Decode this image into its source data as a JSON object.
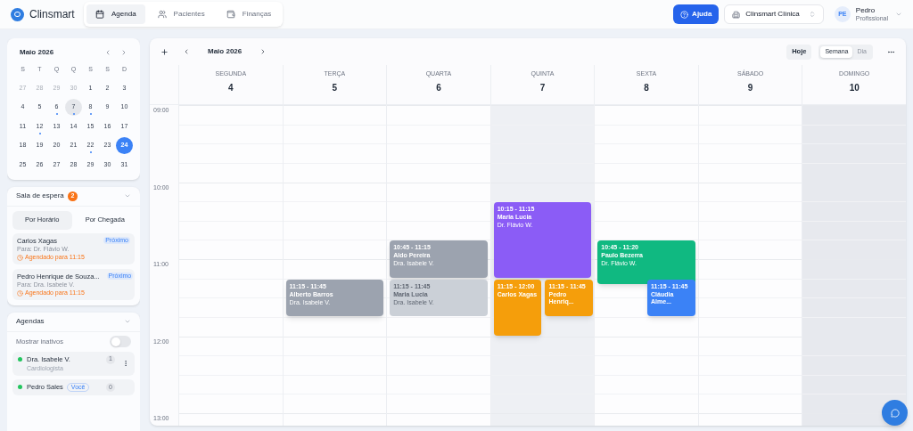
{
  "header": {
    "brand": "Clinsmart",
    "nav": [
      {
        "label": "Agenda",
        "kind": "calendar",
        "selected": true
      },
      {
        "label": "Pacientes",
        "kind": "users",
        "selected": false
      },
      {
        "label": "Finanças",
        "kind": "wallet",
        "selected": false
      }
    ],
    "help_button": "Ajuda",
    "clinic": "Clinsmart Clínica",
    "user": {
      "initials": "PE",
      "name": "Pedro",
      "role": "Profissional"
    }
  },
  "mini_calendar": {
    "title": "Maio 2026",
    "weekdays": [
      "S",
      "T",
      "Q",
      "Q",
      "S",
      "S",
      "D"
    ],
    "days": [
      {
        "label": "27",
        "muted": true,
        "today": false,
        "selected": false,
        "dot": false
      },
      {
        "label": "28",
        "muted": true,
        "today": false,
        "selected": false,
        "dot": false
      },
      {
        "label": "29",
        "muted": true,
        "today": false,
        "selected": false,
        "dot": false
      },
      {
        "label": "30",
        "muted": true,
        "today": false,
        "selected": false,
        "dot": false
      },
      {
        "label": "1",
        "muted": false,
        "today": false,
        "selected": false,
        "dot": false
      },
      {
        "label": "2",
        "muted": false,
        "today": false,
        "selected": false,
        "dot": false
      },
      {
        "label": "3",
        "muted": false,
        "today": false,
        "selected": false,
        "dot": false
      },
      {
        "label": "4",
        "muted": false,
        "today": false,
        "selected": false,
        "dot": false
      },
      {
        "label": "5",
        "muted": false,
        "today": false,
        "selected": false,
        "dot": false
      },
      {
        "label": "6",
        "muted": false,
        "today": false,
        "selected": false,
        "dot": true
      },
      {
        "label": "7",
        "muted": false,
        "today": true,
        "selected": false,
        "dot": true
      },
      {
        "label": "8",
        "muted": false,
        "today": false,
        "selected": false,
        "dot": true
      },
      {
        "label": "9",
        "muted": false,
        "today": false,
        "selected": false,
        "dot": false
      },
      {
        "label": "10",
        "muted": false,
        "today": false,
        "selected": false,
        "dot": false
      },
      {
        "label": "11",
        "muted": false,
        "today": false,
        "selected": false,
        "dot": false
      },
      {
        "label": "12",
        "muted": false,
        "today": false,
        "selected": false,
        "dot": true
      },
      {
        "label": "13",
        "muted": false,
        "today": false,
        "selected": false,
        "dot": false
      },
      {
        "label": "14",
        "muted": false,
        "today": false,
        "selected": false,
        "dot": false
      },
      {
        "label": "15",
        "muted": false,
        "today": false,
        "selected": false,
        "dot": false
      },
      {
        "label": "16",
        "muted": false,
        "today": false,
        "selected": false,
        "dot": false
      },
      {
        "label": "17",
        "muted": false,
        "today": false,
        "selected": false,
        "dot": false
      },
      {
        "label": "18",
        "muted": false,
        "today": false,
        "selected": false,
        "dot": false
      },
      {
        "label": "19",
        "muted": false,
        "today": false,
        "selected": false,
        "dot": false
      },
      {
        "label": "20",
        "muted": false,
        "today": false,
        "selected": false,
        "dot": false
      },
      {
        "label": "21",
        "muted": false,
        "today": false,
        "selected": false,
        "dot": false
      },
      {
        "label": "22",
        "muted": false,
        "today": false,
        "selected": false,
        "dot": true
      },
      {
        "label": "23",
        "muted": false,
        "today": false,
        "selected": false,
        "dot": false
      },
      {
        "label": "24",
        "muted": false,
        "today": false,
        "selected": true,
        "dot": false
      },
      {
        "label": "25",
        "muted": false,
        "today": false,
        "selected": false,
        "dot": false
      },
      {
        "label": "26",
        "muted": false,
        "today": false,
        "selected": false,
        "dot": false
      },
      {
        "label": "27",
        "muted": false,
        "today": false,
        "selected": false,
        "dot": false
      },
      {
        "label": "28",
        "muted": false,
        "today": false,
        "selected": false,
        "dot": false
      },
      {
        "label": "29",
        "muted": false,
        "today": false,
        "selected": false,
        "dot": false
      },
      {
        "label": "30",
        "muted": false,
        "today": false,
        "selected": false,
        "dot": false
      },
      {
        "label": "31",
        "muted": false,
        "today": false,
        "selected": false,
        "dot": false
      }
    ]
  },
  "waiting_room": {
    "title": "Sala de espera",
    "count": "2",
    "tabs": [
      {
        "label": "Por Horário",
        "selected": true
      },
      {
        "label": "Por Chegada",
        "selected": false
      }
    ],
    "patients": [
      {
        "name": "Carlos Xagas",
        "badge": "Próximo",
        "doctor": "Para: Dr. Flávio W.",
        "scheduled": "Agendado para 11:15"
      },
      {
        "name": "Pedro Henrique de Souza...",
        "badge": "Próximo",
        "doctor": "Para: Dra. Isabele V.",
        "scheduled": "Agendado para 11:15"
      }
    ]
  },
  "agendas": {
    "title": "Agendas",
    "show_inactive": {
      "label": "Mostrar inativos",
      "on": false
    },
    "items": [
      {
        "name": "Dra. Isabele V.",
        "color": "#22c55e",
        "specialty": "Cardiologista",
        "count": "1",
        "menu": true
      },
      {
        "name": "Pedro Sales",
        "color": "#22c55e",
        "tag": "Você",
        "count": "0",
        "menu": false
      }
    ]
  },
  "calendar": {
    "title": "Maio 2026",
    "today_button": "Hoje",
    "views": [
      {
        "label": "Semana",
        "selected": true
      },
      {
        "label": "Dia",
        "selected": false
      }
    ],
    "hours": [
      "09:00",
      "10:00",
      "11:00",
      "12:00",
      "13:00"
    ],
    "days": [
      {
        "weekday": "SEGUNDA",
        "date": "4",
        "highlighted": false,
        "closed": false
      },
      {
        "weekday": "TERÇA",
        "date": "5",
        "highlighted": false,
        "closed": false,
        "events": [
          {
            "time": "11:15 - 11:45",
            "patient": "Alberto Barros",
            "doctor": "Dra. Isabele V.",
            "color": "#9ca3af",
            "dimmed": false
          }
        ]
      },
      {
        "weekday": "QUARTA",
        "date": "6",
        "highlighted": false,
        "closed": false,
        "events": [
          {
            "time": "10:45 - 11:15",
            "patient": "Aldo Pereira",
            "doctor": "Dra. Isabele V.",
            "color": "#9ca3af",
            "dimmed": false
          },
          {
            "time": "11:15 - 11:45",
            "patient": "Maria Lucia",
            "doctor": "Dra. Isabele V.",
            "color": "#cbd0d7",
            "dimmed": true
          }
        ]
      },
      {
        "weekday": "QUINTA",
        "date": "7",
        "highlighted": true,
        "closed": false,
        "events": [
          {
            "time": "10:15 - 11:15",
            "patient": "Maria Lucia",
            "doctor": "Dr. Flávio W.",
            "color": "#8b5cf6",
            "dimmed": false
          },
          {
            "time": "11:15 - 12:00",
            "patient": "Carlos Xagas",
            "color": "#f59e0b",
            "dimmed": false
          },
          {
            "time": "11:15 - 11:45",
            "patient": "Pedro Henriq...",
            "color": "#f59e0b",
            "dimmed": false
          }
        ]
      },
      {
        "weekday": "SEXTA",
        "date": "8",
        "highlighted": false,
        "closed": false,
        "events": [
          {
            "time": "10:45 - 11:20",
            "patient": "Paulo Bezerra",
            "doctor": "Dr. Flávio W.",
            "color": "#10b981",
            "dimmed": false
          },
          {
            "time": "11:15 - 11:45",
            "patient": "Cláudia Alme...",
            "color": "#3b82f6",
            "dimmed": false
          }
        ]
      },
      {
        "weekday": "SÁBADO",
        "date": "9",
        "highlighted": false,
        "closed": false
      },
      {
        "weekday": "DOMINGO",
        "date": "10",
        "highlighted": false,
        "closed": true
      }
    ]
  }
}
